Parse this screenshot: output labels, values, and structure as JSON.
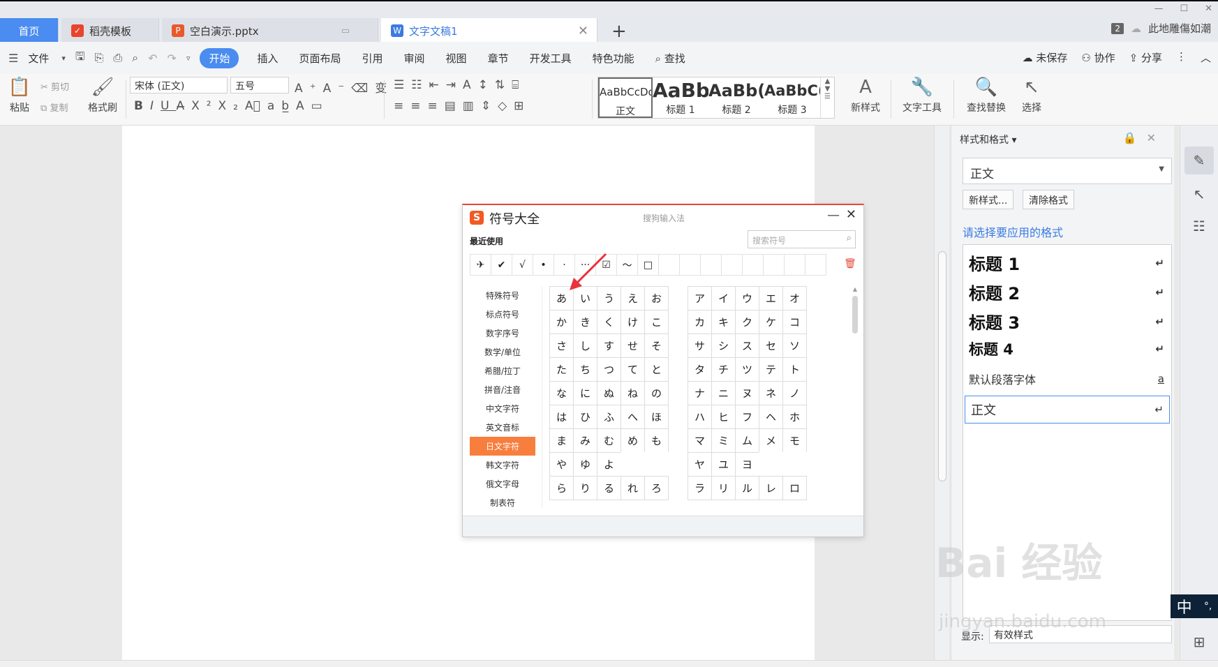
{
  "tabs": {
    "home": "首页",
    "t1": "稻壳模板",
    "t2": "空白演示.pptx",
    "t3": "文字文稿1",
    "badge": "2",
    "user": "此地雕傷如潮"
  },
  "menu": {
    "file": "文件",
    "items": [
      "开始",
      "插入",
      "页面布局",
      "引用",
      "审阅",
      "视图",
      "章节",
      "开发工具",
      "特色功能"
    ],
    "search": "查找",
    "unsaved": "未保存",
    "collab": "协作",
    "share": "分享"
  },
  "ribbon": {
    "paste": "粘贴",
    "cut": "剪切",
    "copy": "复制",
    "format_painter": "格式刷",
    "font_name": "宋体 (正文)",
    "font_size": "五号",
    "styles": [
      {
        "preview": "AaBbCcDd",
        "label": "正文"
      },
      {
        "preview": "AaBb",
        "label": "标题 1"
      },
      {
        "preview": "AaBb(",
        "label": "标题 2"
      },
      {
        "preview": "AaBbC(",
        "label": "标题 3"
      }
    ],
    "new_style": "新样式",
    "text_tools": "文字工具",
    "find_replace": "查找替换",
    "select": "选择"
  },
  "panel": {
    "title": "样式和格式",
    "current_style": "正文",
    "new_style_btn": "新样式...",
    "clear_format_btn": "清除格式",
    "prompt": "请选择要应用的格式",
    "list": [
      {
        "name": "标题  1",
        "mark": "↵"
      },
      {
        "name": "标题  2",
        "mark": "↵"
      },
      {
        "name": "标题  3",
        "mark": "↵"
      },
      {
        "name": "标题  4",
        "mark": "↵"
      },
      {
        "name": "默认段落字体",
        "mark": "a"
      },
      {
        "name": "正文",
        "mark": "↵"
      }
    ],
    "show_label": "显示:",
    "show_value": "有效样式"
  },
  "dialog": {
    "title": "符号大全",
    "subtitle": "搜狗输入法",
    "recent_label": "最近使用",
    "search_placeholder": "搜索符号",
    "recent": [
      "✈",
      "✔",
      "√",
      "•",
      "·",
      "···",
      "☑",
      "～",
      "□",
      "",
      "",
      "",
      "",
      "",
      "",
      "",
      ""
    ],
    "categories": [
      "特殊符号",
      "标点符号",
      "数字序号",
      "数学/单位",
      "希腊/拉丁",
      "拼音/注音",
      "中文字符",
      "英文音标",
      "日文字符",
      "韩文字符",
      "俄文字母",
      "制表符"
    ],
    "selected_category": "日文字符",
    "hiragana": [
      "あ",
      "い",
      "う",
      "え",
      "お",
      "か",
      "き",
      "く",
      "け",
      "こ",
      "さ",
      "し",
      "す",
      "せ",
      "そ",
      "た",
      "ち",
      "つ",
      "て",
      "と",
      "な",
      "に",
      "ぬ",
      "ね",
      "の",
      "は",
      "ひ",
      "ふ",
      "へ",
      "ほ",
      "ま",
      "み",
      "む",
      "め",
      "も",
      "や",
      "ゆ",
      "よ",
      "",
      "",
      "ら",
      "り",
      "る",
      "れ",
      "ろ"
    ],
    "katakana": [
      "ア",
      "イ",
      "ウ",
      "エ",
      "オ",
      "カ",
      "キ",
      "ク",
      "ケ",
      "コ",
      "サ",
      "シ",
      "ス",
      "セ",
      "ソ",
      "タ",
      "チ",
      "ツ",
      "テ",
      "ト",
      "ナ",
      "ニ",
      "ヌ",
      "ネ",
      "ノ",
      "ハ",
      "ヒ",
      "フ",
      "ヘ",
      "ホ",
      "マ",
      "ミ",
      "ム",
      "メ",
      "モ",
      "ヤ",
      "ユ",
      "ヨ",
      "",
      "",
      "ラ",
      "リ",
      "ル",
      "レ",
      "ロ"
    ]
  },
  "ime": "中",
  "watermark": {
    "main": "Bai 经验",
    "sub": "jingyan.baidu.com"
  },
  "colors": {
    "accent": "#4a8cf0",
    "sogou_orange": "#f87e3e",
    "arrow": "#e8323c"
  }
}
